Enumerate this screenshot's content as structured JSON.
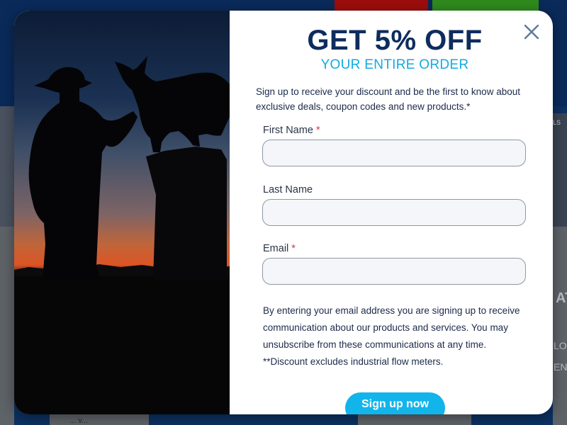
{
  "background": {
    "right_heading_fragment": "AT",
    "right_line_1": "LO",
    "right_line_2": "ENS",
    "right_card_label": "ELS",
    "bottom_label": "... v..."
  },
  "popup": {
    "headline": "GET 5% OFF",
    "subheadline": "YOUR ENTIRE ORDER",
    "intro": "Sign up to receive your discount and be the first to know about exclusive deals, coupon codes and new products.*",
    "required_marker": "*",
    "fields": {
      "first_name": {
        "label": "First Name",
        "value": "",
        "placeholder": ""
      },
      "last_name": {
        "label": "Last Name",
        "value": "",
        "placeholder": ""
      },
      "email": {
        "label": "Email",
        "value": "",
        "placeholder": ""
      }
    },
    "disclaimer_1": "By entering your email address you are signing up to receive communication about our products and services. You may unsubscribe from these communications at any time.",
    "disclaimer_2": "**Discount excludes industrial flow meters.",
    "submit_label": "Sign up now",
    "close_icon": "close-icon"
  },
  "colors": {
    "headline": "#0e2c5e",
    "accent": "#12b4ec",
    "required": "#d23a3a"
  }
}
